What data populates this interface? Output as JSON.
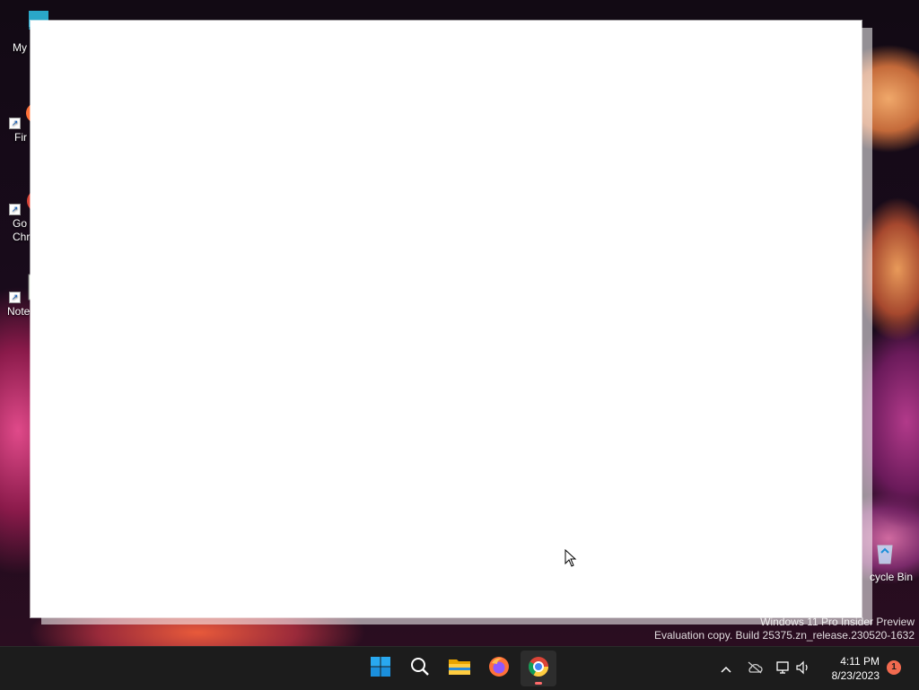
{
  "desktop": {
    "icons": [
      {
        "label": "My Co",
        "icon": "computer-icon"
      },
      {
        "label": "Fir",
        "icon": "firefox-icon"
      },
      {
        "label": "Go\nChr",
        "icon": "chrome-icon"
      },
      {
        "label": "Note",
        "icon": "notepad-icon"
      }
    ],
    "recycle_bin": {
      "label": "cycle Bin",
      "icon": "recycle-bin-icon"
    }
  },
  "window": {
    "title": "",
    "state": "blank"
  },
  "watermark": {
    "line1": "Windows 11 Pro Insider Preview",
    "line2": "Evaluation copy. Build 25375.zn_release.230520-1632"
  },
  "taskbar": {
    "items": [
      {
        "name": "start",
        "icon": "windows-logo-icon"
      },
      {
        "name": "search",
        "icon": "search-icon"
      },
      {
        "name": "file-explorer",
        "icon": "folder-icon"
      },
      {
        "name": "firefox",
        "icon": "firefox-icon"
      },
      {
        "name": "chrome",
        "icon": "chrome-icon",
        "active": true
      }
    ],
    "tray": {
      "chevron": "chevron-up-icon",
      "onedrive": "cloud-off-icon",
      "network": "network-icon",
      "volume": "speaker-icon"
    },
    "clock": {
      "time": "4:11 PM",
      "date": "8/23/2023"
    },
    "notification_count": "1"
  },
  "colors": {
    "taskbar_bg": "#1c1c1c",
    "accent_active": "#ff6a6a",
    "notification_badge": "#f26a4f",
    "windows_blue": "#0f6cbd"
  }
}
